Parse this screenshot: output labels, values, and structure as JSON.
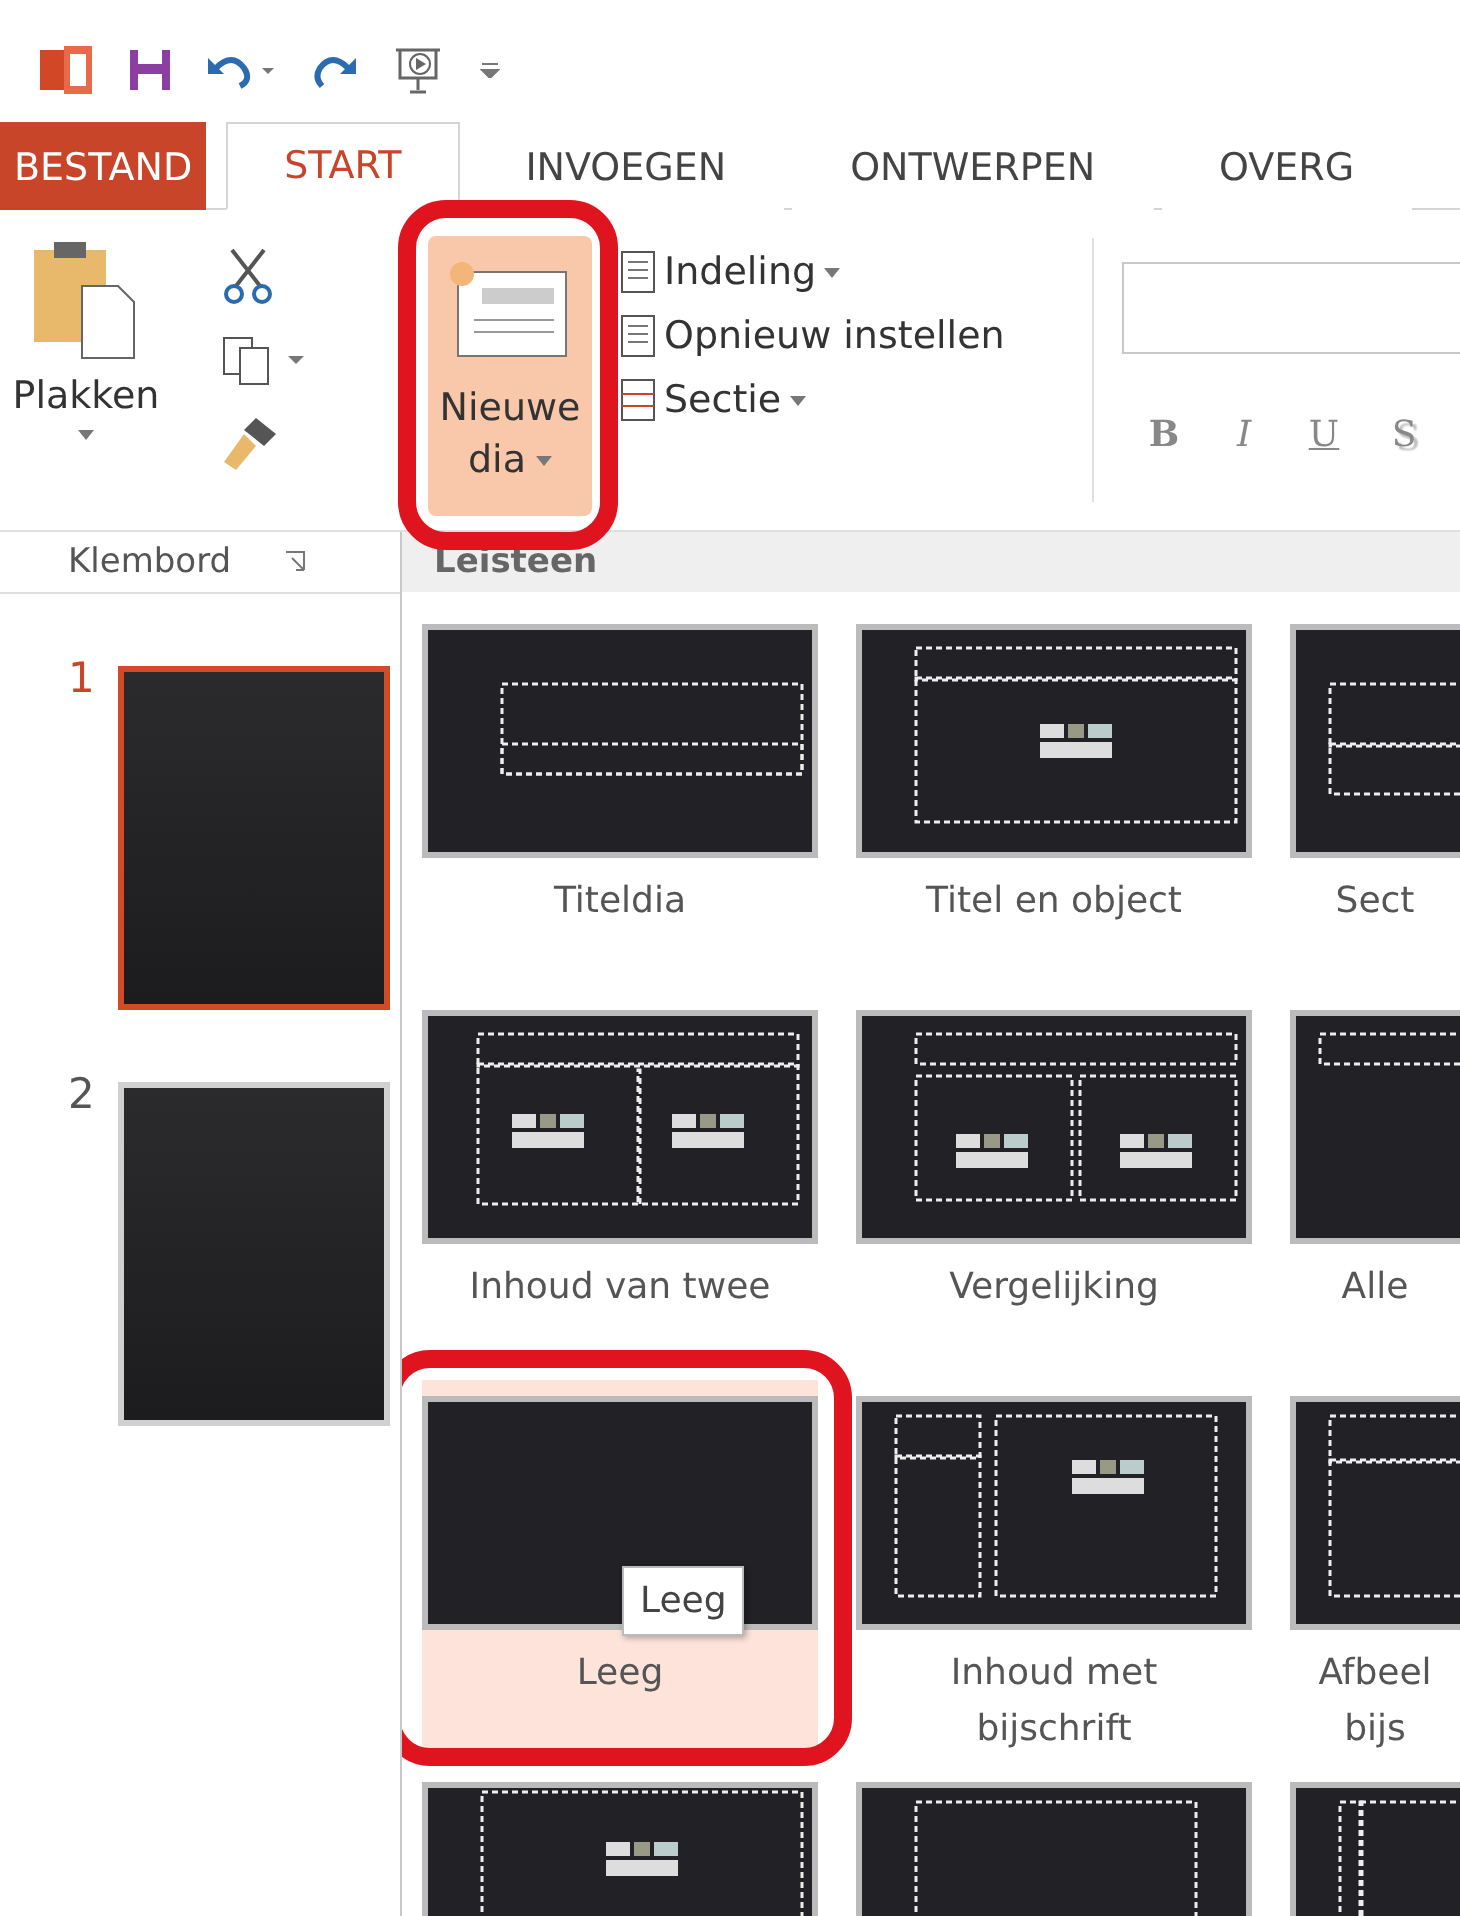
{
  "tabs": [
    {
      "label": "BESTAND",
      "kind": "file",
      "selected": false
    },
    {
      "label": "START",
      "kind": "tab",
      "selected": true
    },
    {
      "label": "INVOEGEN",
      "kind": "tab",
      "selected": false
    },
    {
      "label": "ONTWERPEN",
      "kind": "tab",
      "selected": false
    },
    {
      "label": "OVERG",
      "kind": "tab",
      "selected": false
    }
  ],
  "ribbon": {
    "paste": "Plakken",
    "group_label": "Klembord",
    "new_slide": {
      "line_1": "Nieuwe",
      "line_2": "dia",
      "pressed": true,
      "annotated": true
    },
    "slide_commands": [
      {
        "label": "Indeling",
        "dropdown": true
      },
      {
        "label": "Opnieuw instellen",
        "dropdown": false
      },
      {
        "label": "Sectie",
        "dropdown": true
      }
    ],
    "format_buttons": [
      {
        "label": "B",
        "kind": "bold"
      },
      {
        "label": "I",
        "kind": "italic"
      },
      {
        "label": "U",
        "kind": "underline"
      },
      {
        "label": "S",
        "kind": "shadow"
      }
    ]
  },
  "slides": [
    {
      "number": "1",
      "selected": true
    },
    {
      "number": "2",
      "selected": false
    }
  ],
  "gallery": {
    "title": "Leisteen",
    "tooltip": "Leeg",
    "layouts": [
      {
        "label": "Titeldia",
        "kind": "title",
        "hovered": false,
        "annotated": false
      },
      {
        "label": "Titel en object",
        "kind": "title_object",
        "hovered": false,
        "annotated": false
      },
      {
        "label": "Sect",
        "kind": "section",
        "hovered": false,
        "annotated": false
      },
      {
        "label": "Inhoud van twee",
        "kind": "two_content",
        "hovered": false,
        "annotated": false
      },
      {
        "label": "Vergelijking",
        "kind": "comparison",
        "hovered": false,
        "annotated": false
      },
      {
        "label": "Alle",
        "kind": "title_only",
        "hovered": false,
        "annotated": false
      },
      {
        "label": "Leeg",
        "kind": "blank",
        "hovered": true,
        "annotated": true
      },
      {
        "label": "Inhoud met\nbijschrift",
        "kind": "content_caption",
        "hovered": false,
        "annotated": false
      },
      {
        "label": "Afbeel\nbijs",
        "kind": "picture_caption",
        "hovered": false,
        "annotated": false
      },
      {
        "kind": "small_object",
        "hovered": false,
        "annotated": false
      },
      {
        "kind": "frame",
        "hovered": false,
        "annotated": false
      },
      {
        "kind": "vertical",
        "hovered": false,
        "annotated": false
      }
    ]
  }
}
